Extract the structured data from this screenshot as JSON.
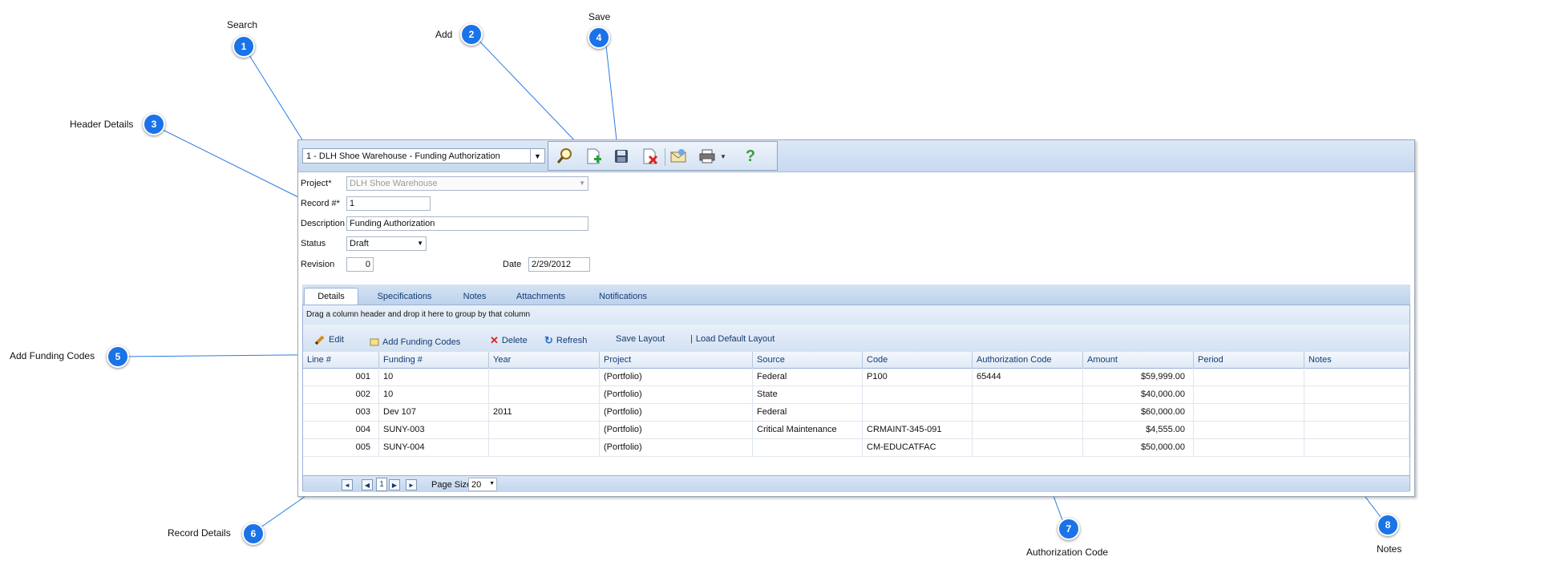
{
  "callouts": [
    {
      "num": "1",
      "label": "Search"
    },
    {
      "num": "2",
      "label": "Add"
    },
    {
      "num": "3",
      "label": "Header Details"
    },
    {
      "num": "4",
      "label": "Save"
    },
    {
      "num": "5",
      "label": "Add Funding Codes"
    },
    {
      "num": "6",
      "label": "Record Details"
    },
    {
      "num": "7",
      "label": "Authorization Code"
    },
    {
      "num": "8",
      "label": "Notes"
    }
  ],
  "search": {
    "value": "1 - DLH Shoe Warehouse - Funding Authorization"
  },
  "form": {
    "project_label": "Project*",
    "project_value": "DLH Shoe Warehouse",
    "record_label": "Record #*",
    "record_value": "1",
    "description_label": "Description",
    "description_value": "Funding Authorization",
    "status_label": "Status",
    "status_value": "Draft",
    "revision_label": "Revision",
    "revision_value": "0",
    "date_label": "Date",
    "date_value": "2/29/2012"
  },
  "tabs": [
    "Details",
    "Specifications",
    "Notes",
    "Attachments",
    "Notifications"
  ],
  "grid": {
    "group_hint": "Drag a column header and drop it here to group by that column",
    "commands": {
      "edit": "Edit",
      "add_funding": "Add Funding Codes",
      "delete": "Delete",
      "refresh": "Refresh",
      "save_layout": "Save Layout",
      "load_default": "Load Default Layout"
    },
    "columns": [
      "Line #",
      "Funding #",
      "Year",
      "Project",
      "Source",
      "Code",
      "Authorization Code",
      "Amount",
      "Period",
      "Notes"
    ],
    "rows": [
      [
        "001",
        "10",
        "",
        "(Portfolio)",
        "Federal",
        "P100",
        "65444",
        "$59,999.00",
        "",
        ""
      ],
      [
        "002",
        "10",
        "",
        "(Portfolio)",
        "State",
        "",
        "",
        "$40,000.00",
        "",
        ""
      ],
      [
        "003",
        "Dev 107",
        "2011",
        "(Portfolio)",
        "Federal",
        "",
        "",
        "$60,000.00",
        "",
        ""
      ],
      [
        "004",
        "SUNY-003",
        "",
        "(Portfolio)",
        "Critical Maintenance",
        "CRMAINT-345-091",
        "",
        "$4,555.00",
        "",
        ""
      ],
      [
        "005",
        "SUNY-004",
        "",
        "(Portfolio)",
        "",
        "CM-EDUCATFAC",
        "",
        "$50,000.00",
        "",
        ""
      ]
    ],
    "pager": {
      "current_page": "1",
      "page_size_label": "Page Size",
      "page_size": "20"
    }
  }
}
